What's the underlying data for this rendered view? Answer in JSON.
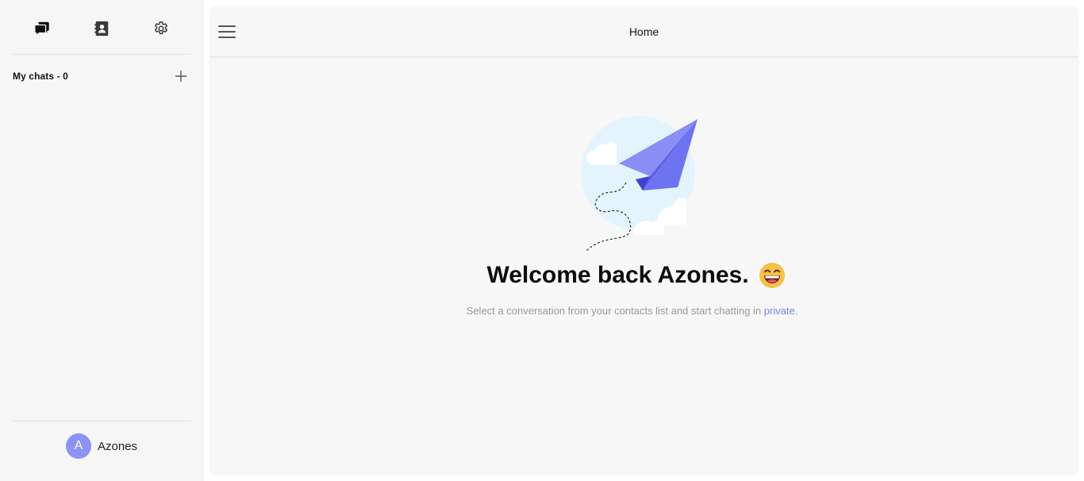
{
  "sidebar": {
    "tabs": [
      {
        "name": "chats-icon"
      },
      {
        "name": "contacts-icon"
      },
      {
        "name": "settings-icon"
      }
    ],
    "chats_header": "My chats - 0",
    "user": {
      "initial": "A",
      "name": "Azones"
    }
  },
  "main": {
    "title": "Home",
    "welcome": {
      "heading": "Welcome back Azones.",
      "subtitle_prefix": "Select a conversation from your contacts list and start chatting in ",
      "subtitle_link": "private",
      "subtitle_suffix": "."
    }
  },
  "colors": {
    "accent": "#8b93f5",
    "link": "#7a83e8",
    "sidebar_bg": "#f6f6f6",
    "main_bg": "#f8f7f8"
  }
}
